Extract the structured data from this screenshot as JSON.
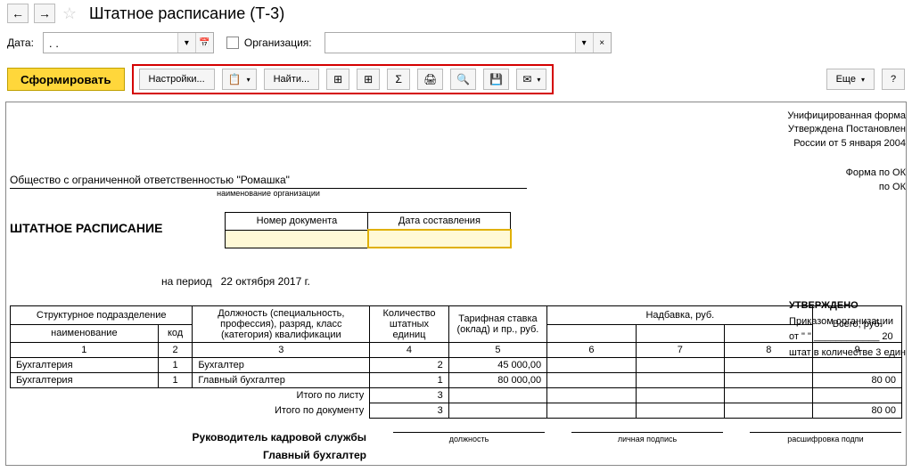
{
  "nav": {
    "back": "←",
    "forward": "→"
  },
  "title": "Штатное расписание (Т-3)",
  "filter": {
    "date_label": "Дата:",
    "date_value": ". .",
    "org_label": "Организация:",
    "org_value": ""
  },
  "toolbar": {
    "form": "Сформировать",
    "settings": "Настройки...",
    "find": "Найти...",
    "more": "Еще"
  },
  "icons": {
    "copy": "📋",
    "expand1": "⊞",
    "expand2": "⊞",
    "sigma": "Σ",
    "print": "🖨",
    "preview": "🔍",
    "save": "💾",
    "mail": "✉"
  },
  "report": {
    "form_header1": "Унифицированная форма",
    "form_header2": "Утверждена Постановлен",
    "form_header3": "России от 5 января 2004",
    "forma_okud": "Форма по ОК",
    "po_okpo": "по ОК",
    "org_name": "Общество с ограниченной ответственностью \"Ромашка\"",
    "org_caption": "наименование организации",
    "doc_title": "ШТАТНОЕ РАСПИСАНИЕ",
    "hdr_docnum": "Номер документа",
    "hdr_docdate": "Дата составления",
    "approved": {
      "title": "УТВЕРЖДЕНО",
      "line1": "Приказом организации",
      "line2": "от \"      \" ____________ 20",
      "line3": "штат в количестве 3 един"
    },
    "period_label": "на период",
    "period_value": "22 октября 2017 г.",
    "table": {
      "headers": {
        "subunit": "Структурное  подразделение",
        "subunit_name": "наименование",
        "subunit_code": "код",
        "position": "Должность (специальность, профессия), разряд, класс (категория) квалификации",
        "qty": "Количество штатных единиц",
        "rate": "Тарифная ставка (оклад) и пр., руб.",
        "bonus": "Надбавка, руб.",
        "total": "Всего, руб."
      },
      "colnums": [
        "1",
        "2",
        "3",
        "4",
        "5",
        "6",
        "7",
        "8",
        "9"
      ],
      "rows": [
        {
          "name": "Бухгалтерия",
          "code": "1",
          "pos": "Бухгалтер",
          "qty": "2",
          "rate": "45 000,00",
          "total": ""
        },
        {
          "name": "Бухгалтерия",
          "code": "1",
          "pos": "Главный бухгалтер",
          "qty": "1",
          "rate": "80 000,00",
          "total": "80 00"
        }
      ],
      "totals_sheet_label": "Итого по листу",
      "totals_sheet_qty": "3",
      "totals_sheet_total": "",
      "totals_doc_label": "Итого по документу",
      "totals_doc_qty": "3",
      "totals_doc_total": "80 00"
    },
    "signatures": {
      "hr_head": "Руководитель кадровой службы",
      "chief_acc": "Главный бухгалтер",
      "s_dolzh": "должность",
      "s_sign": "личная подпись",
      "s_name": "расшифровка  подпи"
    }
  }
}
